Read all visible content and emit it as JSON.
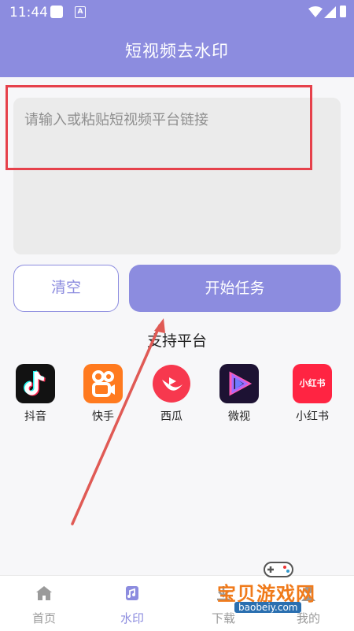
{
  "status_bar": {
    "time": "11:44",
    "a_icon": "A"
  },
  "header": {
    "title": "短视频去水印"
  },
  "link_input": {
    "placeholder": "请输入或粘贴短视频平台链接",
    "value": ""
  },
  "buttons": {
    "clear": "清空",
    "start": "开始任务"
  },
  "platforms": {
    "title": "支持平台",
    "items": [
      {
        "name": "抖音",
        "icon": "douyin-icon"
      },
      {
        "name": "快手",
        "icon": "kuaishou-icon"
      },
      {
        "name": "西瓜",
        "icon": "xigua-icon"
      },
      {
        "name": "微视",
        "icon": "weishi-icon"
      },
      {
        "name": "小红书",
        "icon": "xiaohongshu-icon",
        "logo_text": "小红书"
      }
    ]
  },
  "bottom_nav": {
    "items": [
      {
        "label": "首页",
        "icon": "home-icon",
        "active": false
      },
      {
        "label": "水印",
        "icon": "watermark-icon",
        "active": true
      },
      {
        "label": "下载",
        "icon": "download-icon",
        "active": false
      },
      {
        "label": "我的",
        "icon": "profile-icon",
        "active": false
      }
    ]
  },
  "watermark": {
    "text": "宝贝游戏网",
    "url": "baobeiy.com"
  },
  "colors": {
    "accent": "#8c8cdf",
    "highlight_box": "#e6414b",
    "annotation_arrow": "#e05a55",
    "nav_inactive": "#9a9a9a"
  }
}
